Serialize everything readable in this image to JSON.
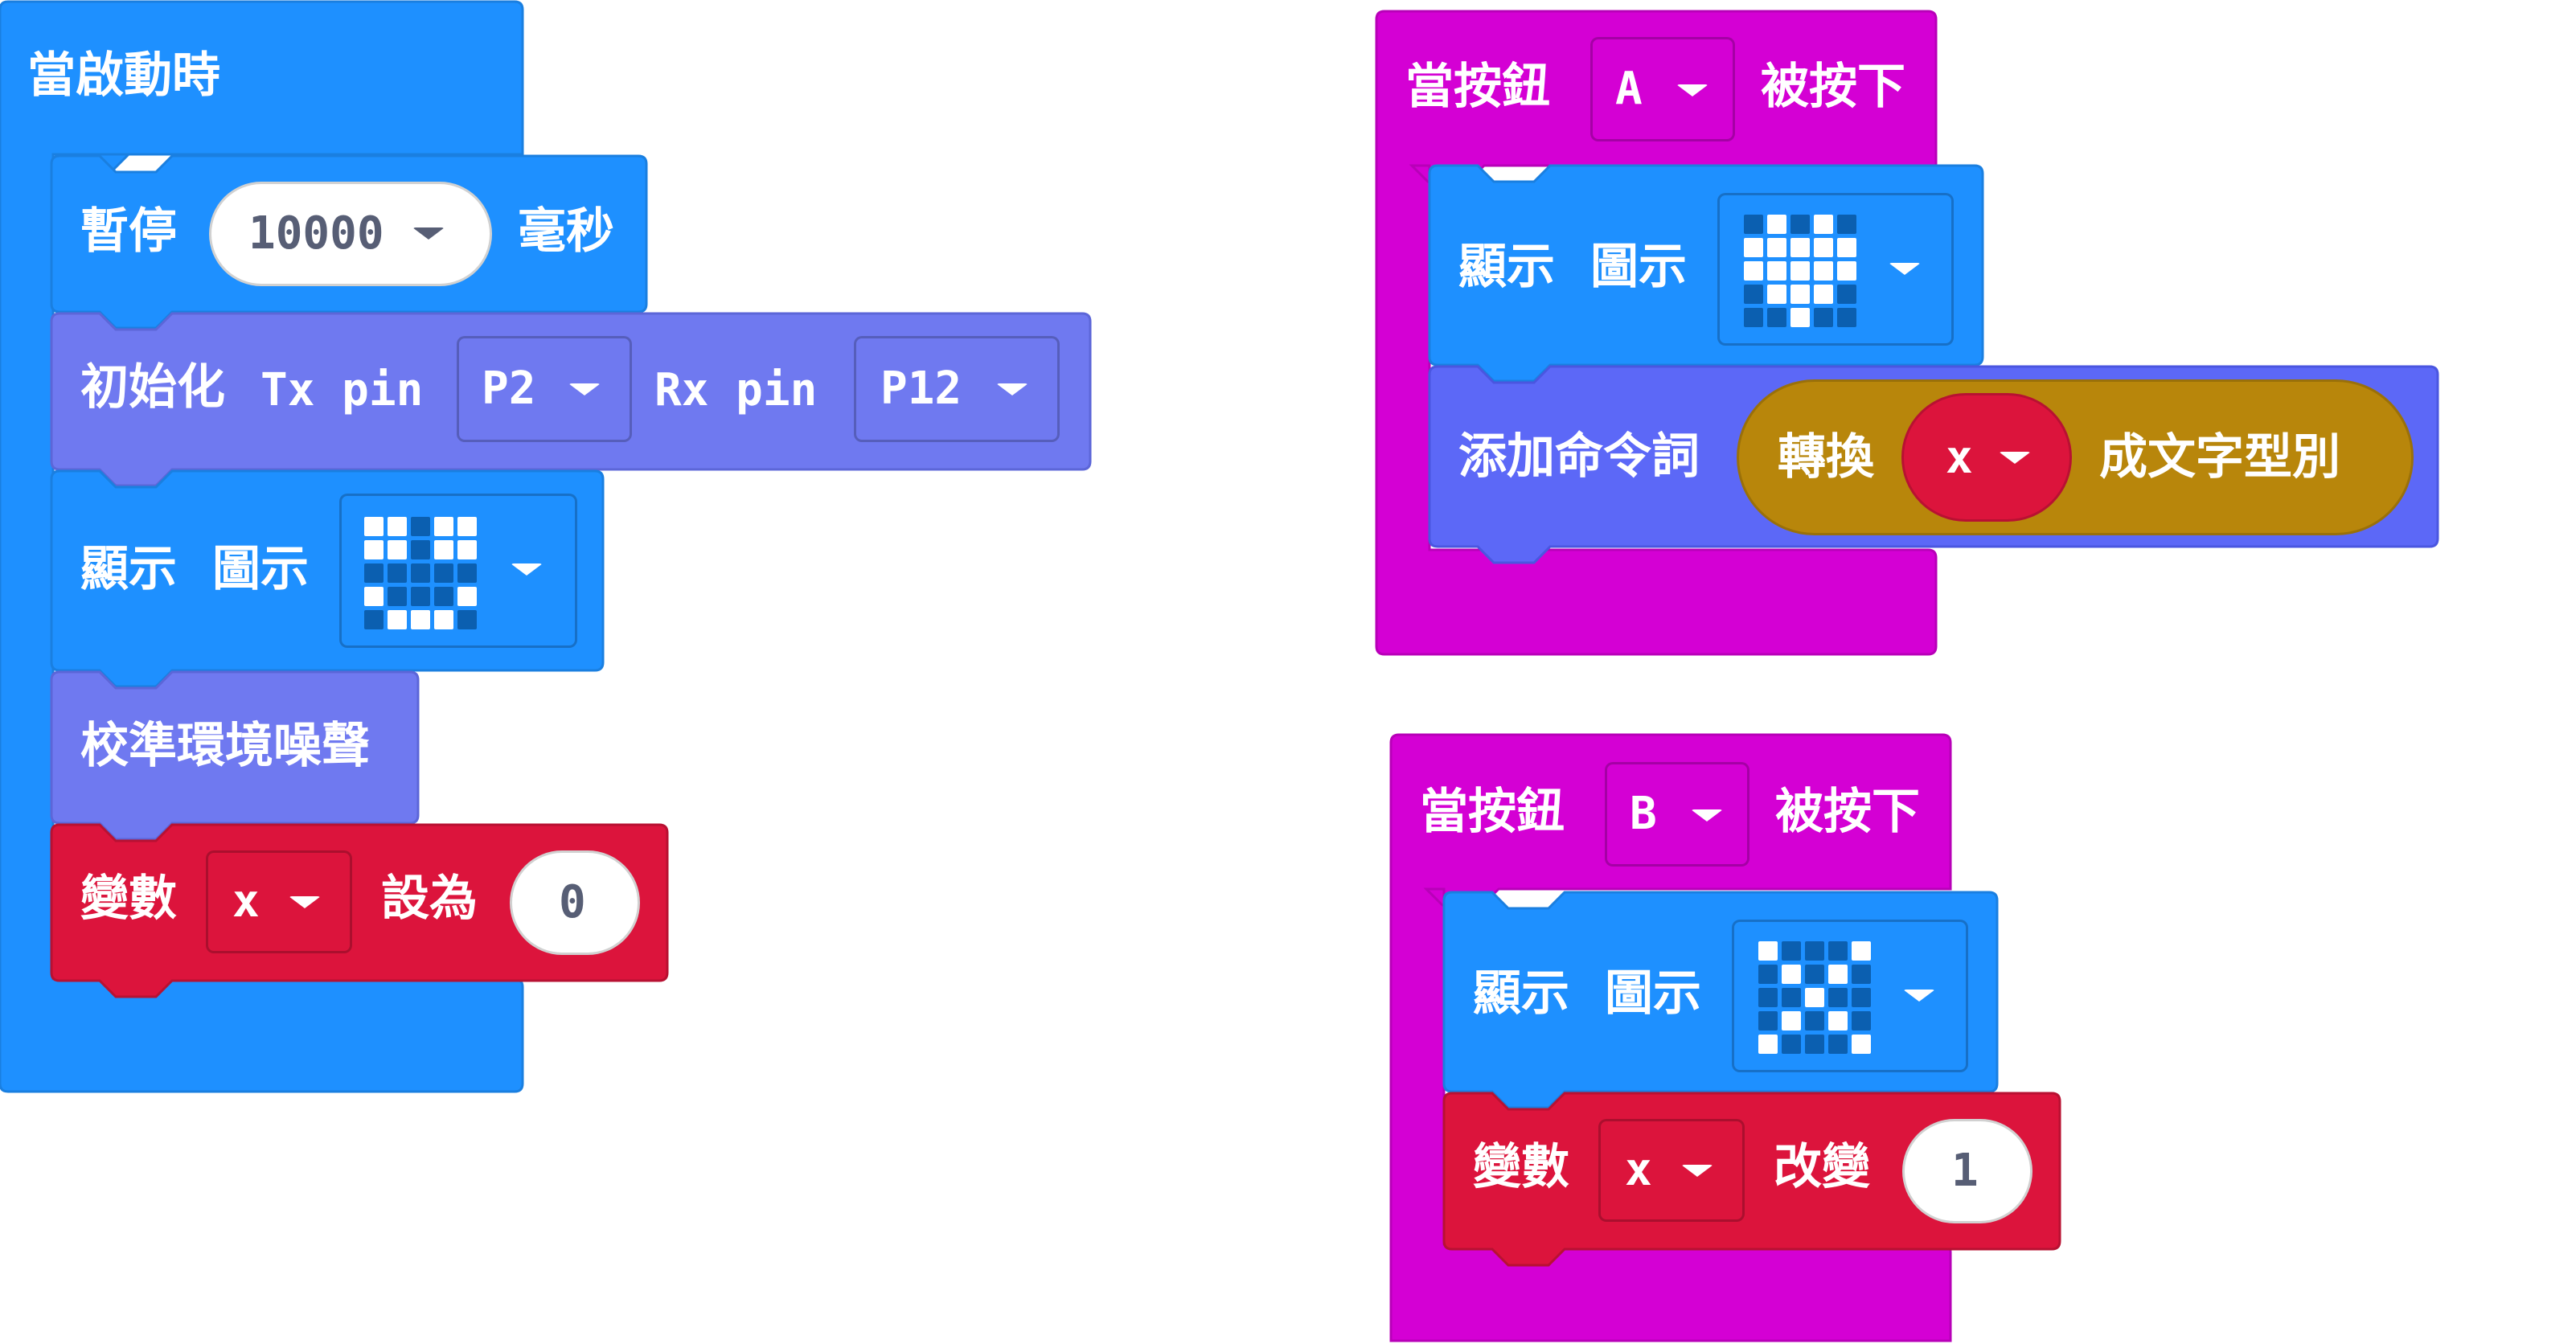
{
  "colors": {
    "event_purple": "#d400d4",
    "basic_blue": "#1e90ff",
    "radio_purple": "#6f79f0",
    "serial_purple": "#5c68f7",
    "variable_red": "#dc143c",
    "text_gold": "#b8860b",
    "led_on": "#ffffff",
    "led_off": "#0b5fb0"
  },
  "on_start": {
    "label": "當啟動時",
    "pause": {
      "label": "暫停",
      "value": "10000",
      "unit": "毫秒"
    },
    "serial_init": {
      "label": "初始化",
      "tx_label": "Tx pin",
      "tx_value": "P2",
      "rx_label": "Rx pin",
      "rx_value": "P12"
    },
    "show_icon": {
      "label": "顯示",
      "sublabel": "圖示",
      "icon": "happy-face",
      "leds": [
        [
          1,
          1,
          0,
          1,
          1
        ],
        [
          1,
          1,
          0,
          1,
          1
        ],
        [
          0,
          0,
          0,
          0,
          0
        ],
        [
          1,
          0,
          0,
          0,
          1
        ],
        [
          0,
          1,
          1,
          1,
          0
        ]
      ]
    },
    "calibrate": {
      "label": "校準環境噪聲"
    },
    "set_var": {
      "label": "變數",
      "var": "x",
      "op": "設為",
      "value": "0"
    }
  },
  "on_button_a": {
    "label": "當按鈕",
    "button": "A",
    "suffix": "被按下",
    "show_icon": {
      "label": "顯示",
      "sublabel": "圖示",
      "icon": "heart",
      "leds": [
        [
          0,
          1,
          0,
          1,
          0
        ],
        [
          1,
          1,
          1,
          1,
          1
        ],
        [
          1,
          1,
          1,
          1,
          1
        ],
        [
          0,
          1,
          1,
          1,
          0
        ],
        [
          0,
          0,
          1,
          0,
          0
        ]
      ]
    },
    "add_command": {
      "label": "添加命令詞",
      "convert_label": "轉換",
      "var": "x",
      "suffix": "成文字型別"
    }
  },
  "on_button_b": {
    "label": "當按鈕",
    "button": "B",
    "suffix": "被按下",
    "show_icon": {
      "label": "顯示",
      "sublabel": "圖示",
      "icon": "cross",
      "leds": [
        [
          1,
          0,
          0,
          0,
          1
        ],
        [
          0,
          1,
          0,
          1,
          0
        ],
        [
          0,
          0,
          1,
          0,
          0
        ],
        [
          0,
          1,
          0,
          1,
          0
        ],
        [
          1,
          0,
          0,
          0,
          1
        ]
      ]
    },
    "change_var": {
      "label": "變數",
      "var": "x",
      "op": "改變",
      "value": "1"
    }
  }
}
